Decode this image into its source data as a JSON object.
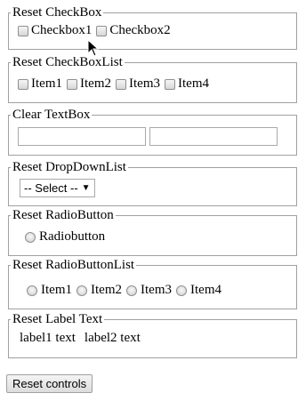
{
  "sections": {
    "checkbox": {
      "legend": "Reset CheckBox",
      "items": [
        {
          "label": "Checkbox1",
          "checked": false
        },
        {
          "label": "Checkbox2",
          "checked": false
        }
      ]
    },
    "checkboxlist": {
      "legend": "Reset CheckBoxList",
      "items": [
        {
          "label": "Item1",
          "checked": false
        },
        {
          "label": "Item2",
          "checked": false
        },
        {
          "label": "Item3",
          "checked": false
        },
        {
          "label": "Item4",
          "checked": false
        }
      ]
    },
    "textbox": {
      "legend": "Clear TextBox",
      "values": [
        "",
        ""
      ]
    },
    "dropdown": {
      "legend": "Reset DropDownList",
      "selected": "-- Select --"
    },
    "radiobutton": {
      "legend": "Reset RadioButton",
      "label": "Radiobutton",
      "checked": false
    },
    "radiolist": {
      "legend": "Reset RadioButtonList",
      "items": [
        {
          "label": "Item1",
          "checked": false
        },
        {
          "label": "Item2",
          "checked": false
        },
        {
          "label": "Item3",
          "checked": false
        },
        {
          "label": "Item4",
          "checked": false
        }
      ]
    },
    "label": {
      "legend": "Reset Label Text",
      "label1": "label1 text",
      "label2": "label2 text"
    }
  },
  "reset_button": "Reset controls",
  "icons": {
    "cursor": "mouse-pointer-icon",
    "dropdown_arrow": "triangle-down-icon"
  }
}
